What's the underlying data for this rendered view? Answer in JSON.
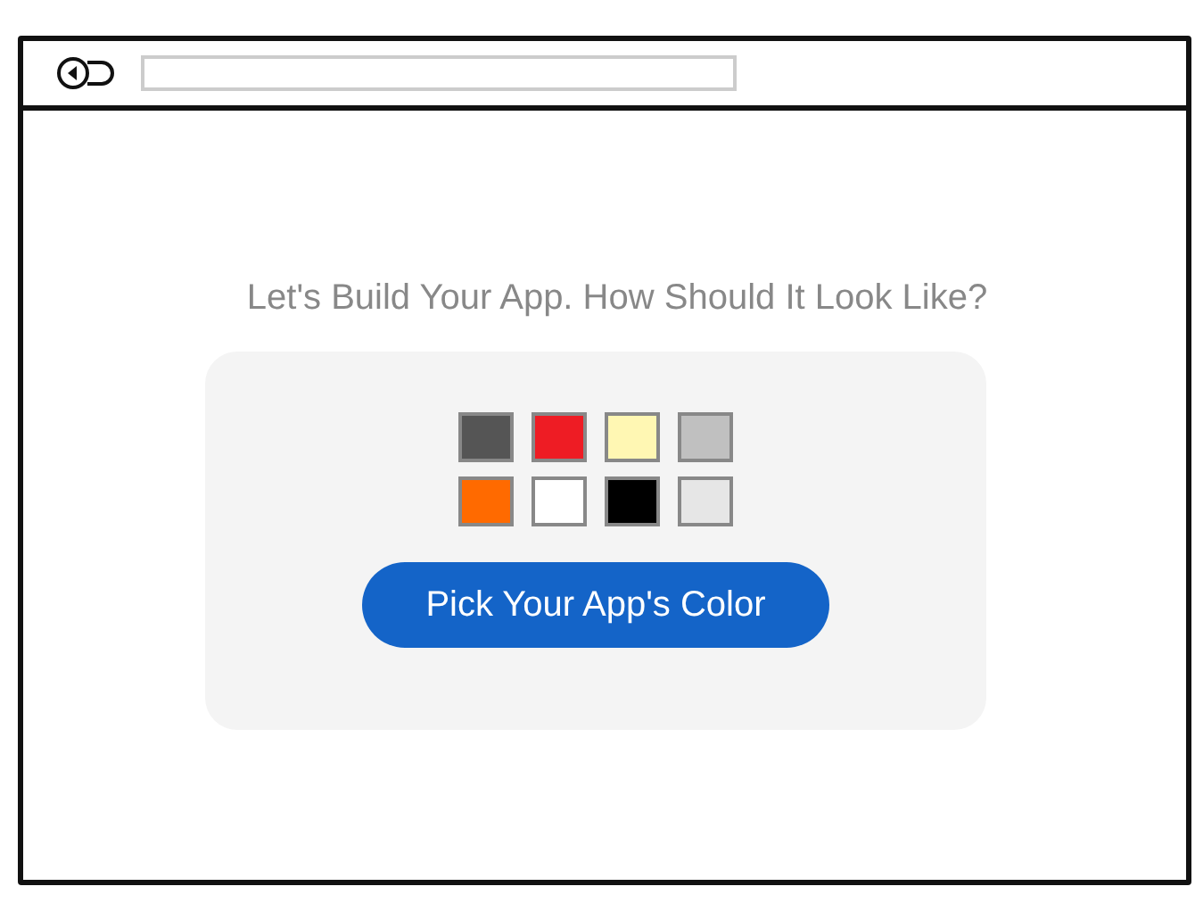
{
  "heading": "Let's Build Your App. How Should It Look Like?",
  "swatches": [
    {
      "color": "#555555"
    },
    {
      "color": "#ee1c24"
    },
    {
      "color": "#fff7b3"
    },
    {
      "color": "#c0c0c0"
    },
    {
      "color": "#ff6a00"
    },
    {
      "color": "#ffffff"
    },
    {
      "color": "#000000"
    },
    {
      "color": "#e6e6e6"
    }
  ],
  "button": {
    "label": "Pick Your App's Color"
  }
}
